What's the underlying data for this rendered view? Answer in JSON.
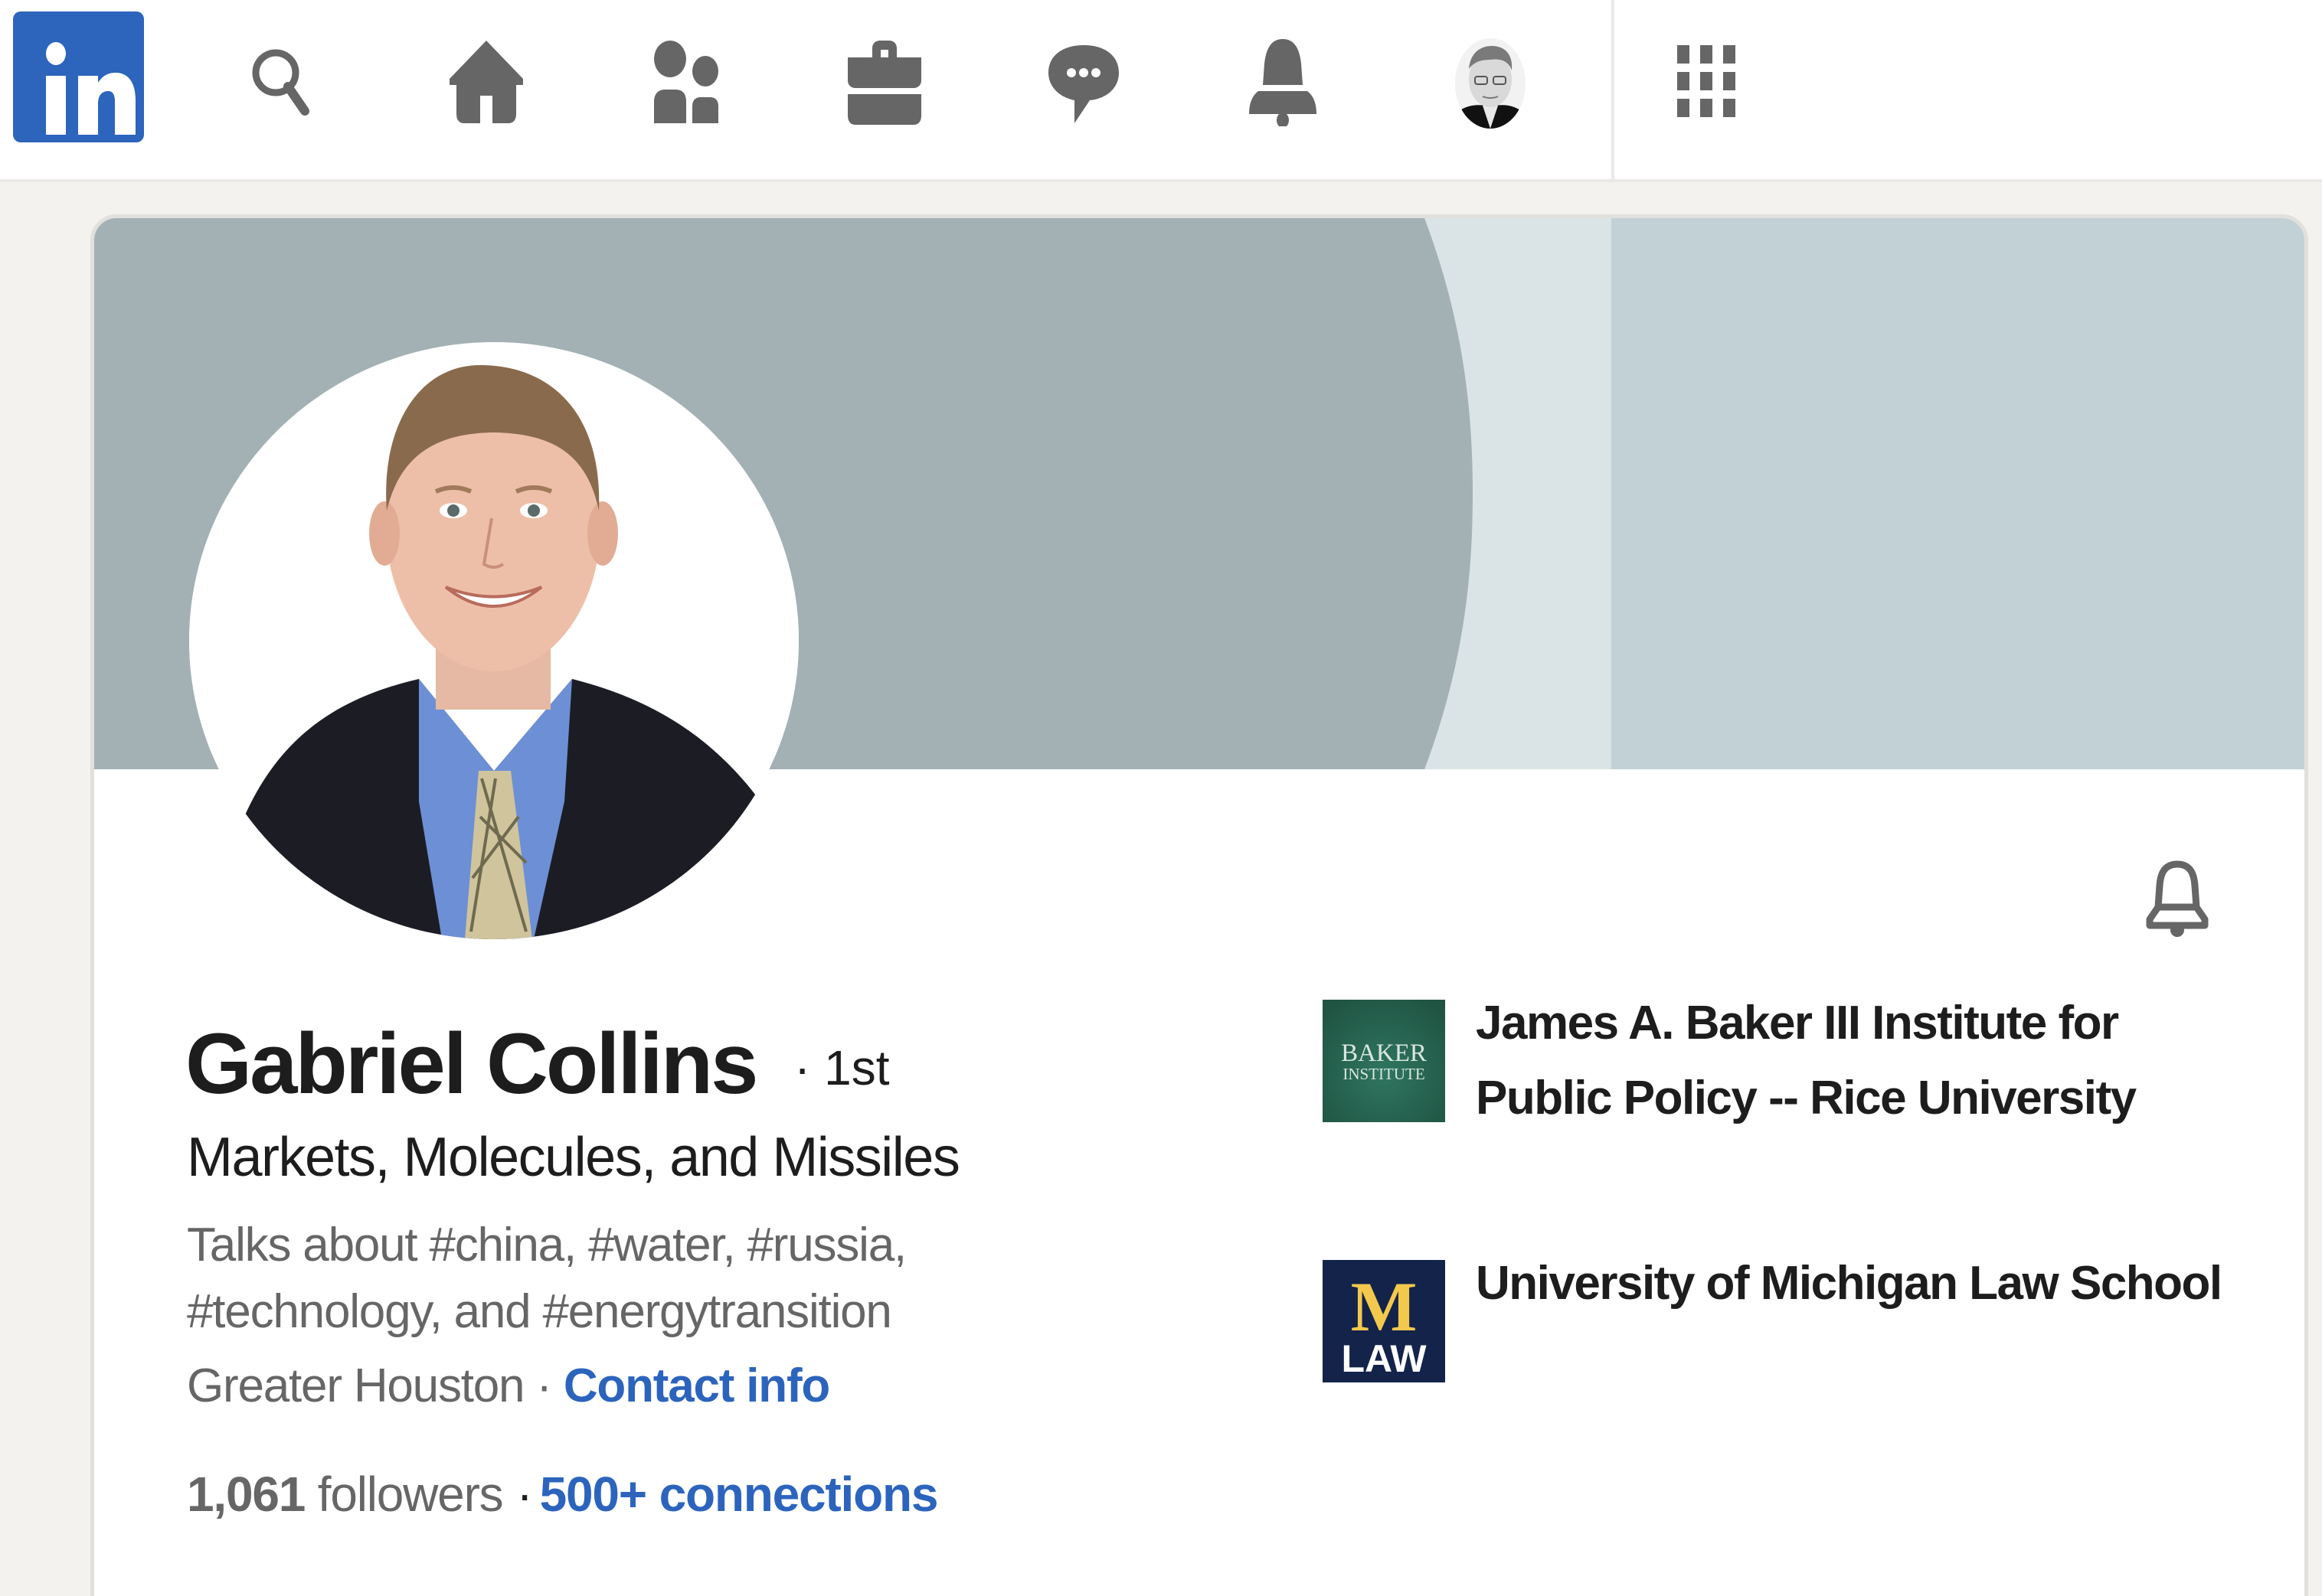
{
  "nav": {
    "logo": "in",
    "icons": [
      {
        "name": "search-icon",
        "label": "Search"
      },
      {
        "name": "home-icon",
        "label": "Home"
      },
      {
        "name": "my-network-icon",
        "label": "My Network"
      },
      {
        "name": "jobs-icon",
        "label": "Jobs"
      },
      {
        "name": "messaging-icon",
        "label": "Messaging"
      },
      {
        "name": "notifications-icon",
        "label": "Notifications"
      },
      {
        "name": "me-avatar",
        "label": "Me"
      },
      {
        "name": "apps-grid-icon",
        "label": "Work"
      }
    ]
  },
  "profile": {
    "name": "Gabriel Collins",
    "degree": "· 1st",
    "headline": "Markets, Molecules, and Missiles",
    "talks_about": "Talks about #china, #water, #russia, #technology, and #energytransition",
    "location": "Greater Houston",
    "location_sep": " · ",
    "contact_info": "Contact info",
    "followers_count": "1,061",
    "followers_label": " followers",
    "stats_sep": "·",
    "connections": "500+ connections"
  },
  "organizations": [
    {
      "name": "James A. Baker III Institute for Public Policy -- Rice University",
      "logo_line1": "BAKER",
      "logo_line2": "INSTITUTE"
    },
    {
      "name": "University of Michigan Law School",
      "logo_line1": "M",
      "logo_line2": "LAW"
    }
  ],
  "colors": {
    "brand": "#2d64bc",
    "link": "#2c64bd",
    "icon": "#666666",
    "banner_dark": "#a3b1b5",
    "banner_stripe": "#dae4e6",
    "banner_right": "#c2d1d5",
    "baker_green": "#2a6650",
    "michigan_navy": "#13234a",
    "michigan_maize": "#f2c94c"
  }
}
